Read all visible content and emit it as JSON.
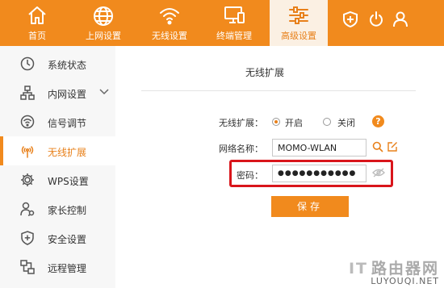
{
  "nav": {
    "items": [
      {
        "label": "首页",
        "icon": "home-icon"
      },
      {
        "label": "上网设置",
        "icon": "globe-icon"
      },
      {
        "label": "无线设置",
        "icon": "wifi-icon"
      },
      {
        "label": "终端管理",
        "icon": "monitor-icon"
      },
      {
        "label": "高级设置",
        "icon": "sliders-icon",
        "active": true
      }
    ],
    "right_icons": [
      "plus-shield-icon",
      "power-icon",
      "user-icon"
    ]
  },
  "sidebar": {
    "items": [
      {
        "label": "系统状态",
        "icon": "clock-icon"
      },
      {
        "label": "内网设置",
        "icon": "network-icon",
        "has_submenu": true
      },
      {
        "label": "信号调节",
        "icon": "signal-icon"
      },
      {
        "label": "无线扩展",
        "icon": "wireless-extend-icon",
        "active": true
      },
      {
        "label": "WPS设置",
        "icon": "gear-icon"
      },
      {
        "label": "家长控制",
        "icon": "parent-control-icon"
      },
      {
        "label": "安全设置",
        "icon": "shield-icon"
      },
      {
        "label": "远程管理",
        "icon": "remote-icon"
      }
    ]
  },
  "main": {
    "title": "无线扩展",
    "extend": {
      "label": "无线扩展：",
      "options": [
        {
          "label": "开启",
          "checked": true
        },
        {
          "label": "关闭",
          "checked": false
        }
      ],
      "help": "?"
    },
    "ssid": {
      "label": "网络名称：",
      "value": "MOMO-WLAN"
    },
    "password": {
      "label": "密码：",
      "value": "●●●●●●●●●●●"
    },
    "save_label": "保存"
  },
  "colors": {
    "brand": "#f18a1d",
    "highlight": "#d9151b"
  },
  "watermark": {
    "line1_prefix": "IT",
    "line1": "路由器网",
    "line2": "LUYOUQI.NET"
  }
}
